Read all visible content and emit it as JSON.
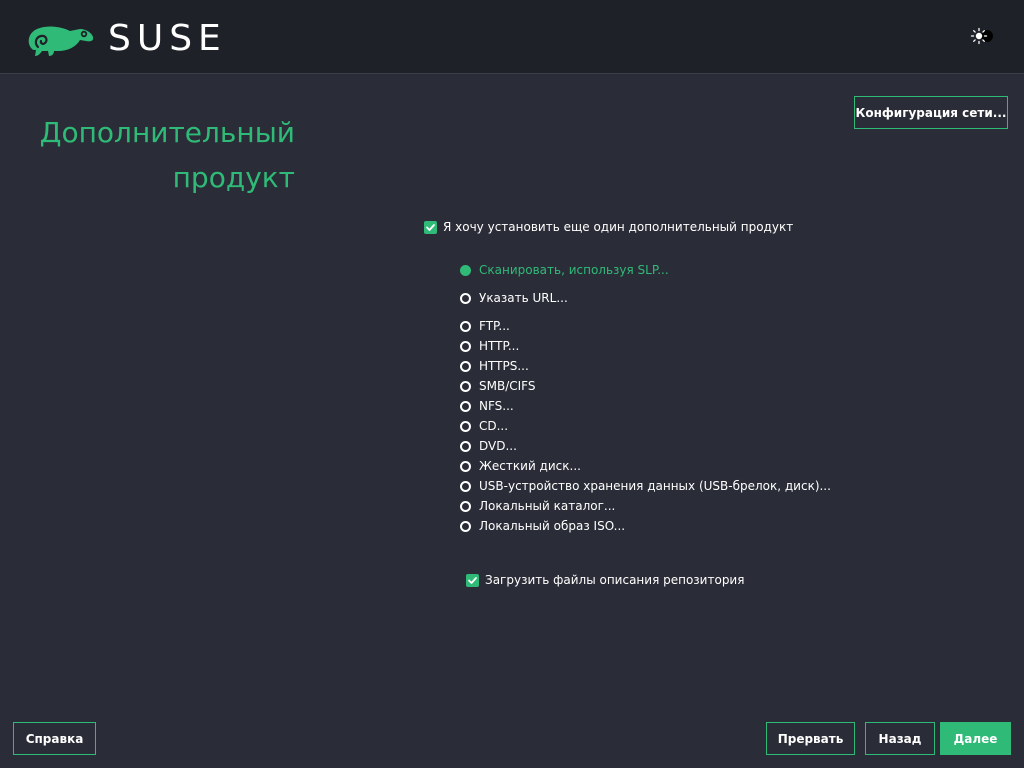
{
  "header": {
    "logo_text": "SUSE",
    "theme_toggle_icon": "sun-moon-icon"
  },
  "page": {
    "title_line1": "Дополнительный",
    "title_line2": "продукт"
  },
  "buttons": {
    "network_config": "Конфигурация сети...",
    "help": "Справка",
    "abort": "Прервать",
    "back": "Назад",
    "next": "Далее"
  },
  "addon_checkbox": {
    "label": "Я хочу установить еще один дополнительный продукт",
    "checked": true
  },
  "sources": [
    {
      "label": "Сканировать, используя SLP...",
      "selected": true
    },
    {
      "label": "Указать URL...",
      "selected": false
    },
    {
      "label": "FTP...",
      "selected": false
    },
    {
      "label": "HTTP...",
      "selected": false
    },
    {
      "label": "HTTPS...",
      "selected": false
    },
    {
      "label": "SMB/CIFS",
      "selected": false
    },
    {
      "label": "NFS...",
      "selected": false
    },
    {
      "label": "CD...",
      "selected": false
    },
    {
      "label": "DVD...",
      "selected": false
    },
    {
      "label": "Жесткий диск...",
      "selected": false
    },
    {
      "label": "USB-устройство хранения данных (USB-брелок, диск)...",
      "selected": false
    },
    {
      "label": "Локальный каталог...",
      "selected": false
    },
    {
      "label": "Локальный образ ISO...",
      "selected": false
    }
  ],
  "download_checkbox": {
    "label": "Загрузить файлы описания репозитория",
    "checked": true
  },
  "colors": {
    "accent": "#30ba78",
    "background": "#2a2d37",
    "header": "#1f2128"
  }
}
